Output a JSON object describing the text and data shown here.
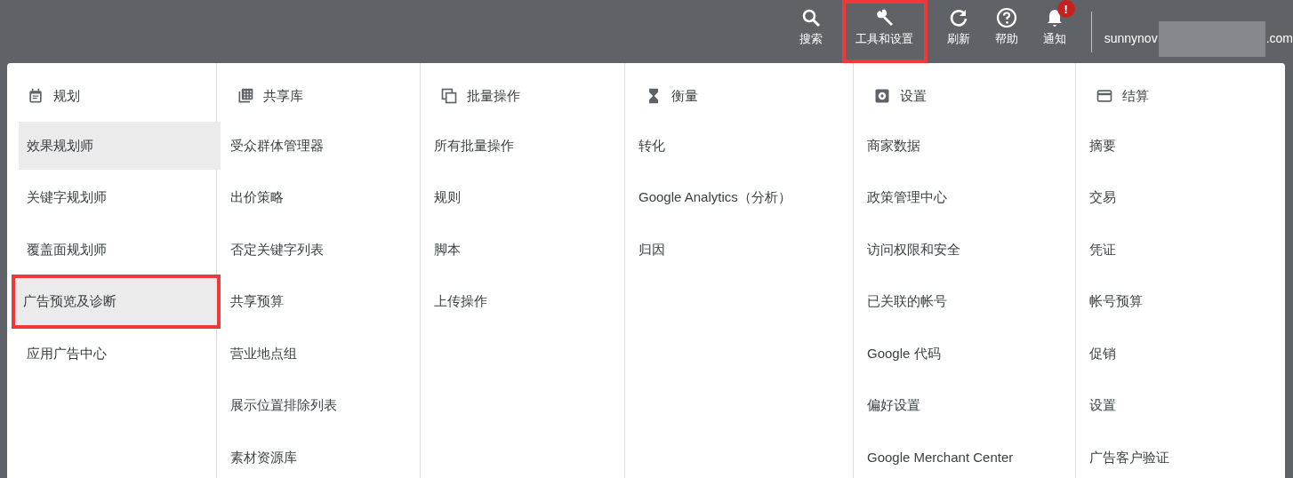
{
  "top_bar": {
    "actions": [
      {
        "kind": "search",
        "label": "搜索",
        "annotated": false
      },
      {
        "kind": "tools",
        "label": "工具和设置",
        "annotated": true
      },
      {
        "kind": "refresh",
        "label": "刷新",
        "annotated": false
      },
      {
        "kind": "help",
        "label": "帮助",
        "annotated": false
      },
      {
        "kind": "bell",
        "label": "通知",
        "annotated": false,
        "badge": "!"
      }
    ],
    "account": {
      "prefix": "sunnynov",
      "suffix": ".com"
    }
  },
  "menu": {
    "columns": [
      {
        "kind": "calendar",
        "title": "规划",
        "items": [
          {
            "label": "效果规划师",
            "highlighted": true,
            "annotated": false
          },
          {
            "label": "关键字规划师",
            "highlighted": false,
            "annotated": false
          },
          {
            "label": "覆盖面规划师",
            "highlighted": false,
            "annotated": false
          },
          {
            "label": "广告预览及诊断",
            "highlighted": true,
            "annotated": true
          },
          {
            "label": "应用广告中心",
            "highlighted": false,
            "annotated": false
          }
        ]
      },
      {
        "kind": "library",
        "title": "共享库",
        "items": [
          {
            "label": "受众群体管理器",
            "highlighted": false,
            "annotated": false
          },
          {
            "label": "出价策略",
            "highlighted": false,
            "annotated": false
          },
          {
            "label": "否定关键字列表",
            "highlighted": false,
            "annotated": false
          },
          {
            "label": "共享预算",
            "highlighted": false,
            "annotated": false
          },
          {
            "label": "营业地点组",
            "highlighted": false,
            "annotated": false
          },
          {
            "label": "展示位置排除列表",
            "highlighted": false,
            "annotated": false
          },
          {
            "label": "素材资源库",
            "highlighted": false,
            "annotated": false
          }
        ]
      },
      {
        "kind": "copy",
        "title": "批量操作",
        "items": [
          {
            "label": "所有批量操作",
            "highlighted": false,
            "annotated": false
          },
          {
            "label": "规则",
            "highlighted": false,
            "annotated": false
          },
          {
            "label": "脚本",
            "highlighted": false,
            "annotated": false
          },
          {
            "label": "上传操作",
            "highlighted": false,
            "annotated": false
          }
        ]
      },
      {
        "kind": "hourglass",
        "title": "衡量",
        "items": [
          {
            "label": "转化",
            "highlighted": false,
            "annotated": false
          },
          {
            "label": "Google Analytics（分析）",
            "highlighted": false,
            "annotated": false
          },
          {
            "label": "归因",
            "highlighted": false,
            "annotated": false
          }
        ]
      },
      {
        "kind": "gear",
        "title": "设置",
        "items": [
          {
            "label": "商家数据",
            "highlighted": false,
            "annotated": false
          },
          {
            "label": "政策管理中心",
            "highlighted": false,
            "annotated": false
          },
          {
            "label": "访问权限和安全",
            "highlighted": false,
            "annotated": false
          },
          {
            "label": "已关联的帐号",
            "highlighted": false,
            "annotated": false
          },
          {
            "label": "Google 代码",
            "highlighted": false,
            "annotated": false
          },
          {
            "label": "偏好设置",
            "highlighted": false,
            "annotated": false
          },
          {
            "label": "Google Merchant Center",
            "highlighted": false,
            "annotated": false
          }
        ]
      },
      {
        "kind": "card",
        "title": "结算",
        "items": [
          {
            "label": "摘要",
            "highlighted": false,
            "annotated": false
          },
          {
            "label": "交易",
            "highlighted": false,
            "annotated": false
          },
          {
            "label": "凭证",
            "highlighted": false,
            "annotated": false
          },
          {
            "label": "帐号预算",
            "highlighted": false,
            "annotated": false
          },
          {
            "label": "促销",
            "highlighted": false,
            "annotated": false
          },
          {
            "label": "设置",
            "highlighted": false,
            "annotated": false
          },
          {
            "label": "广告客户验证",
            "highlighted": false,
            "annotated": false
          }
        ]
      }
    ]
  }
}
